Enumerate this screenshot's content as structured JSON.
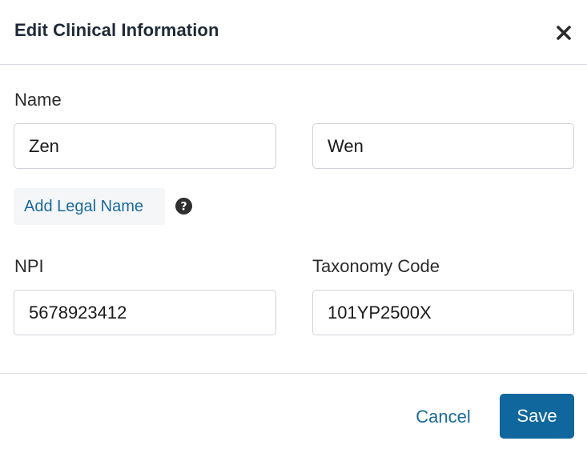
{
  "dialog": {
    "title": "Edit Clinical Information",
    "close_icon": "close-icon"
  },
  "name_section": {
    "label": "Name",
    "first_name": "Zen",
    "last_name": "Wen",
    "add_legal_name_label": "Add Legal Name",
    "help_icon": "question-circle-icon"
  },
  "npi": {
    "label": "NPI",
    "value": "5678923412"
  },
  "taxonomy": {
    "label": "Taxonomy Code",
    "value": "101YP2500X"
  },
  "footer": {
    "cancel_label": "Cancel",
    "save_label": "Save"
  },
  "colors": {
    "accent": "#0f679e",
    "link": "#1a6a9a",
    "border": "#cfd3d9"
  }
}
